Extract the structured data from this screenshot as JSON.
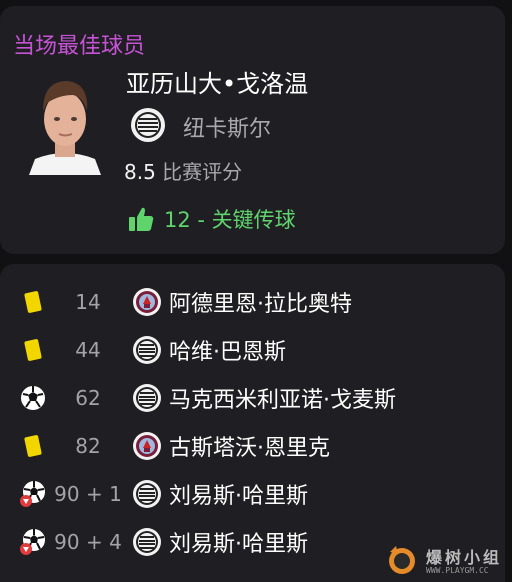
{
  "motm": {
    "title": "当场最佳球员",
    "player_name": "亚历山大•戈洛温",
    "club": "纽卡斯尔",
    "rating": "8.5",
    "rating_label": "比赛评分",
    "key_stat": "12 - 关键传球",
    "stat_color": "#5fd46d",
    "title_color": "#c653d6"
  },
  "events": [
    {
      "type": "yellow-card",
      "minute": "14",
      "team": "opponent",
      "player": "阿德里恩·拉比奥特"
    },
    {
      "type": "yellow-card",
      "minute": "44",
      "team": "newcastle",
      "player": "哈维·巴恩斯"
    },
    {
      "type": "goal",
      "minute": "62",
      "team": "newcastle",
      "player": "马克西米利亚诺·戈麦斯"
    },
    {
      "type": "yellow-card",
      "minute": "82",
      "team": "opponent",
      "player": "古斯塔沃·恩里克"
    },
    {
      "type": "own-goal",
      "minute": "90 + 1",
      "team": "newcastle",
      "player": "刘易斯·哈里斯"
    },
    {
      "type": "own-goal",
      "minute": "90 + 4",
      "team": "newcastle",
      "player": "刘易斯·哈里斯"
    }
  ],
  "watermark": {
    "text": "爆树小组",
    "url": "WWW.PLAYGM.CC"
  }
}
